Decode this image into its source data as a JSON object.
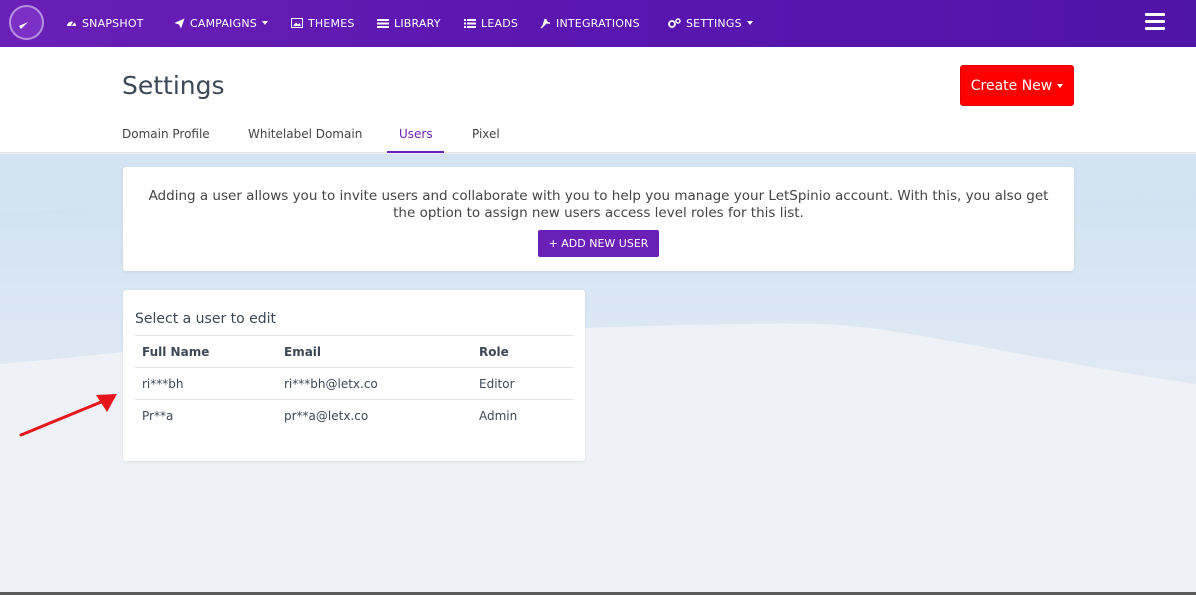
{
  "navbar": {
    "items": [
      {
        "label": "SNAPSHOT",
        "icon": "dashboard-icon"
      },
      {
        "label": "CAMPAIGNS",
        "icon": "paper-plane-icon",
        "dropdown": true
      },
      {
        "label": "THEMES",
        "icon": "image-icon"
      },
      {
        "label": "LIBRARY",
        "icon": "library-icon"
      },
      {
        "label": "LEADS",
        "icon": "list-icon"
      },
      {
        "label": "INTEGRATIONS",
        "icon": "plug-icon"
      },
      {
        "label": "SETTINGS",
        "icon": "cogs-icon",
        "dropdown": true
      }
    ]
  },
  "header": {
    "title": "Settings",
    "create_label": "Create New",
    "tabs": [
      {
        "label": "Domain Profile"
      },
      {
        "label": "Whitelabel Domain"
      },
      {
        "label": "Users",
        "active": true
      },
      {
        "label": "Pixel"
      }
    ]
  },
  "info": {
    "text": "Adding a user allows you to invite users and collaborate with you to help you manage your LetSpinio account. With this, you also get the option to assign new users access level roles for this list.",
    "add_button_label": "+ ADD NEW USER"
  },
  "users": {
    "title": "Select a user to edit",
    "columns": [
      "Full Name",
      "Email",
      "Role"
    ],
    "rows": [
      {
        "name": "ri***bh",
        "email": "ri***bh@letx.co",
        "role": "Editor"
      },
      {
        "name": "Pr**a",
        "email": "pr**a@letx.co",
        "role": "Admin"
      }
    ]
  },
  "colors": {
    "brand_purple": "#6a1fb6",
    "create_red": "#ff0000",
    "annotation_arrow": "#e8141b"
  }
}
